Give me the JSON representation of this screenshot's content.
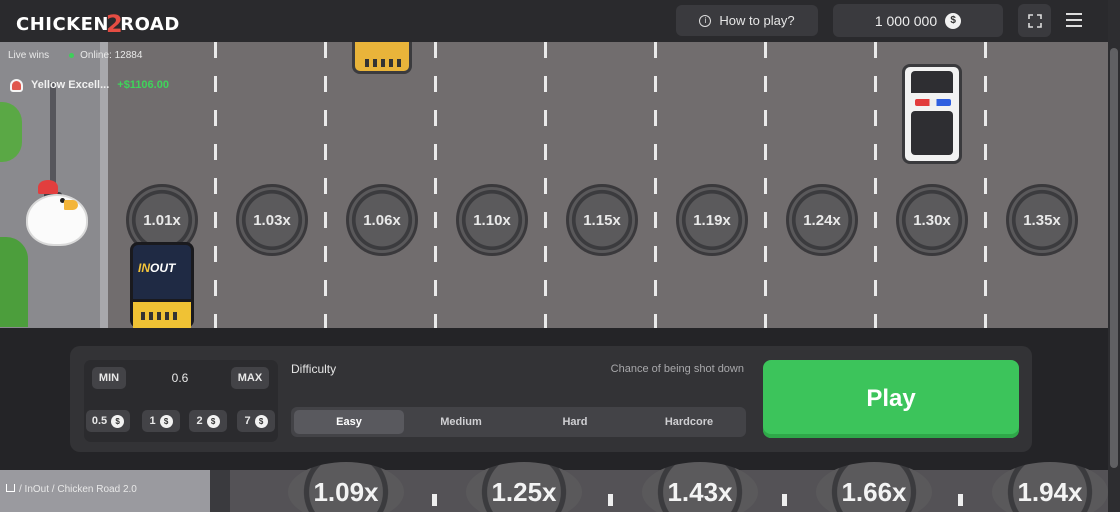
{
  "header": {
    "logo_left": "CHICKEN",
    "logo_num": "2",
    "logo_right": "ROAD",
    "how_to_play": "How to play?",
    "balance": "1 000 000",
    "currency_glyph": "$"
  },
  "live": {
    "label": "Live wins",
    "online": "Online: 12884",
    "latest_user": "Yellow Excell...",
    "latest_amount": "+$1106.00"
  },
  "game": {
    "multipliers": [
      "1.01x",
      "1.03x",
      "1.06x",
      "1.10x",
      "1.15x",
      "1.19x",
      "1.24x",
      "1.30x",
      "1.35x"
    ],
    "truck_brand_a": "IN",
    "truck_brand_b": "OUT"
  },
  "controls": {
    "min_label": "MIN",
    "max_label": "MAX",
    "bet_value": "0.6",
    "quick_bets": [
      "0.5",
      "1",
      "2",
      "7"
    ],
    "difficulty_label": "Difficulty",
    "chance_label": "Chance of being shot down",
    "difficulties": [
      "Easy",
      "Medium",
      "Hard",
      "Hardcore"
    ],
    "selected_difficulty": "Easy",
    "play_label": "Play"
  },
  "footer": {
    "breadcrumb": "/ InOut / Chicken Road 2.0",
    "preview_multipliers": [
      "1.09x",
      "1.25x",
      "1.43x",
      "1.66x",
      "1.94x"
    ]
  },
  "colors": {
    "accent_green": "#3cc45b",
    "win_green": "#3fd45a",
    "road": "#716d6e",
    "panel": "#333336"
  }
}
